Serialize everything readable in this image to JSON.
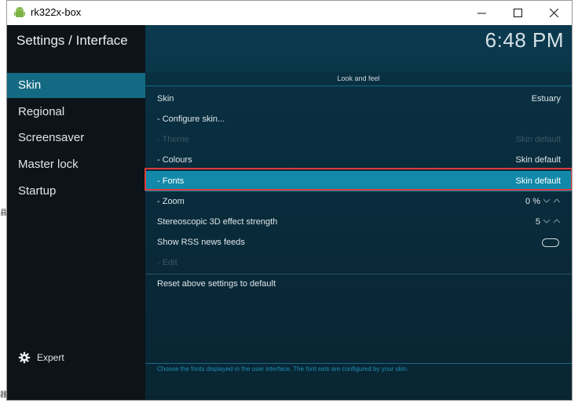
{
  "window": {
    "title": "rk322x-box",
    "minimize": "—",
    "maximize": "☐",
    "close": "✕"
  },
  "header": {
    "breadcrumb": "Settings / Interface",
    "clock": "6:48 PM"
  },
  "sidebar": {
    "items": [
      {
        "label": "Skin",
        "active": true
      },
      {
        "label": "Regional"
      },
      {
        "label": "Screensaver"
      },
      {
        "label": "Master lock"
      },
      {
        "label": "Startup"
      }
    ],
    "expert_label": "Expert"
  },
  "main": {
    "section": "Look and feel",
    "rows": [
      {
        "label": "Skin",
        "value": "Estuary"
      },
      {
        "label": "- Configure skin...",
        "value": ""
      },
      {
        "label": "- Theme",
        "value": "Skin default",
        "disabled": true
      },
      {
        "label": "- Colours",
        "value": "Skin default"
      },
      {
        "label": "- Fonts",
        "value": "Skin default",
        "selected": true
      },
      {
        "label": "- Zoom",
        "value": "0 %"
      },
      {
        "label": "Stereoscopic 3D effect strength",
        "value": "5"
      },
      {
        "label": "Show RSS news feeds",
        "value": ""
      },
      {
        "label": "- Edit",
        "value": "",
        "disabled": true
      }
    ],
    "reset_label": "Reset above settings to default",
    "help_text": "Choose the fonts displayed in the user interface. The font sets are configured by your skin."
  },
  "gutter": {
    "char1": "县",
    "char2": "器"
  },
  "colors": {
    "accent": "#1289a9",
    "selection_border": "#e03a3a",
    "sidebar_active": "#146a82"
  }
}
